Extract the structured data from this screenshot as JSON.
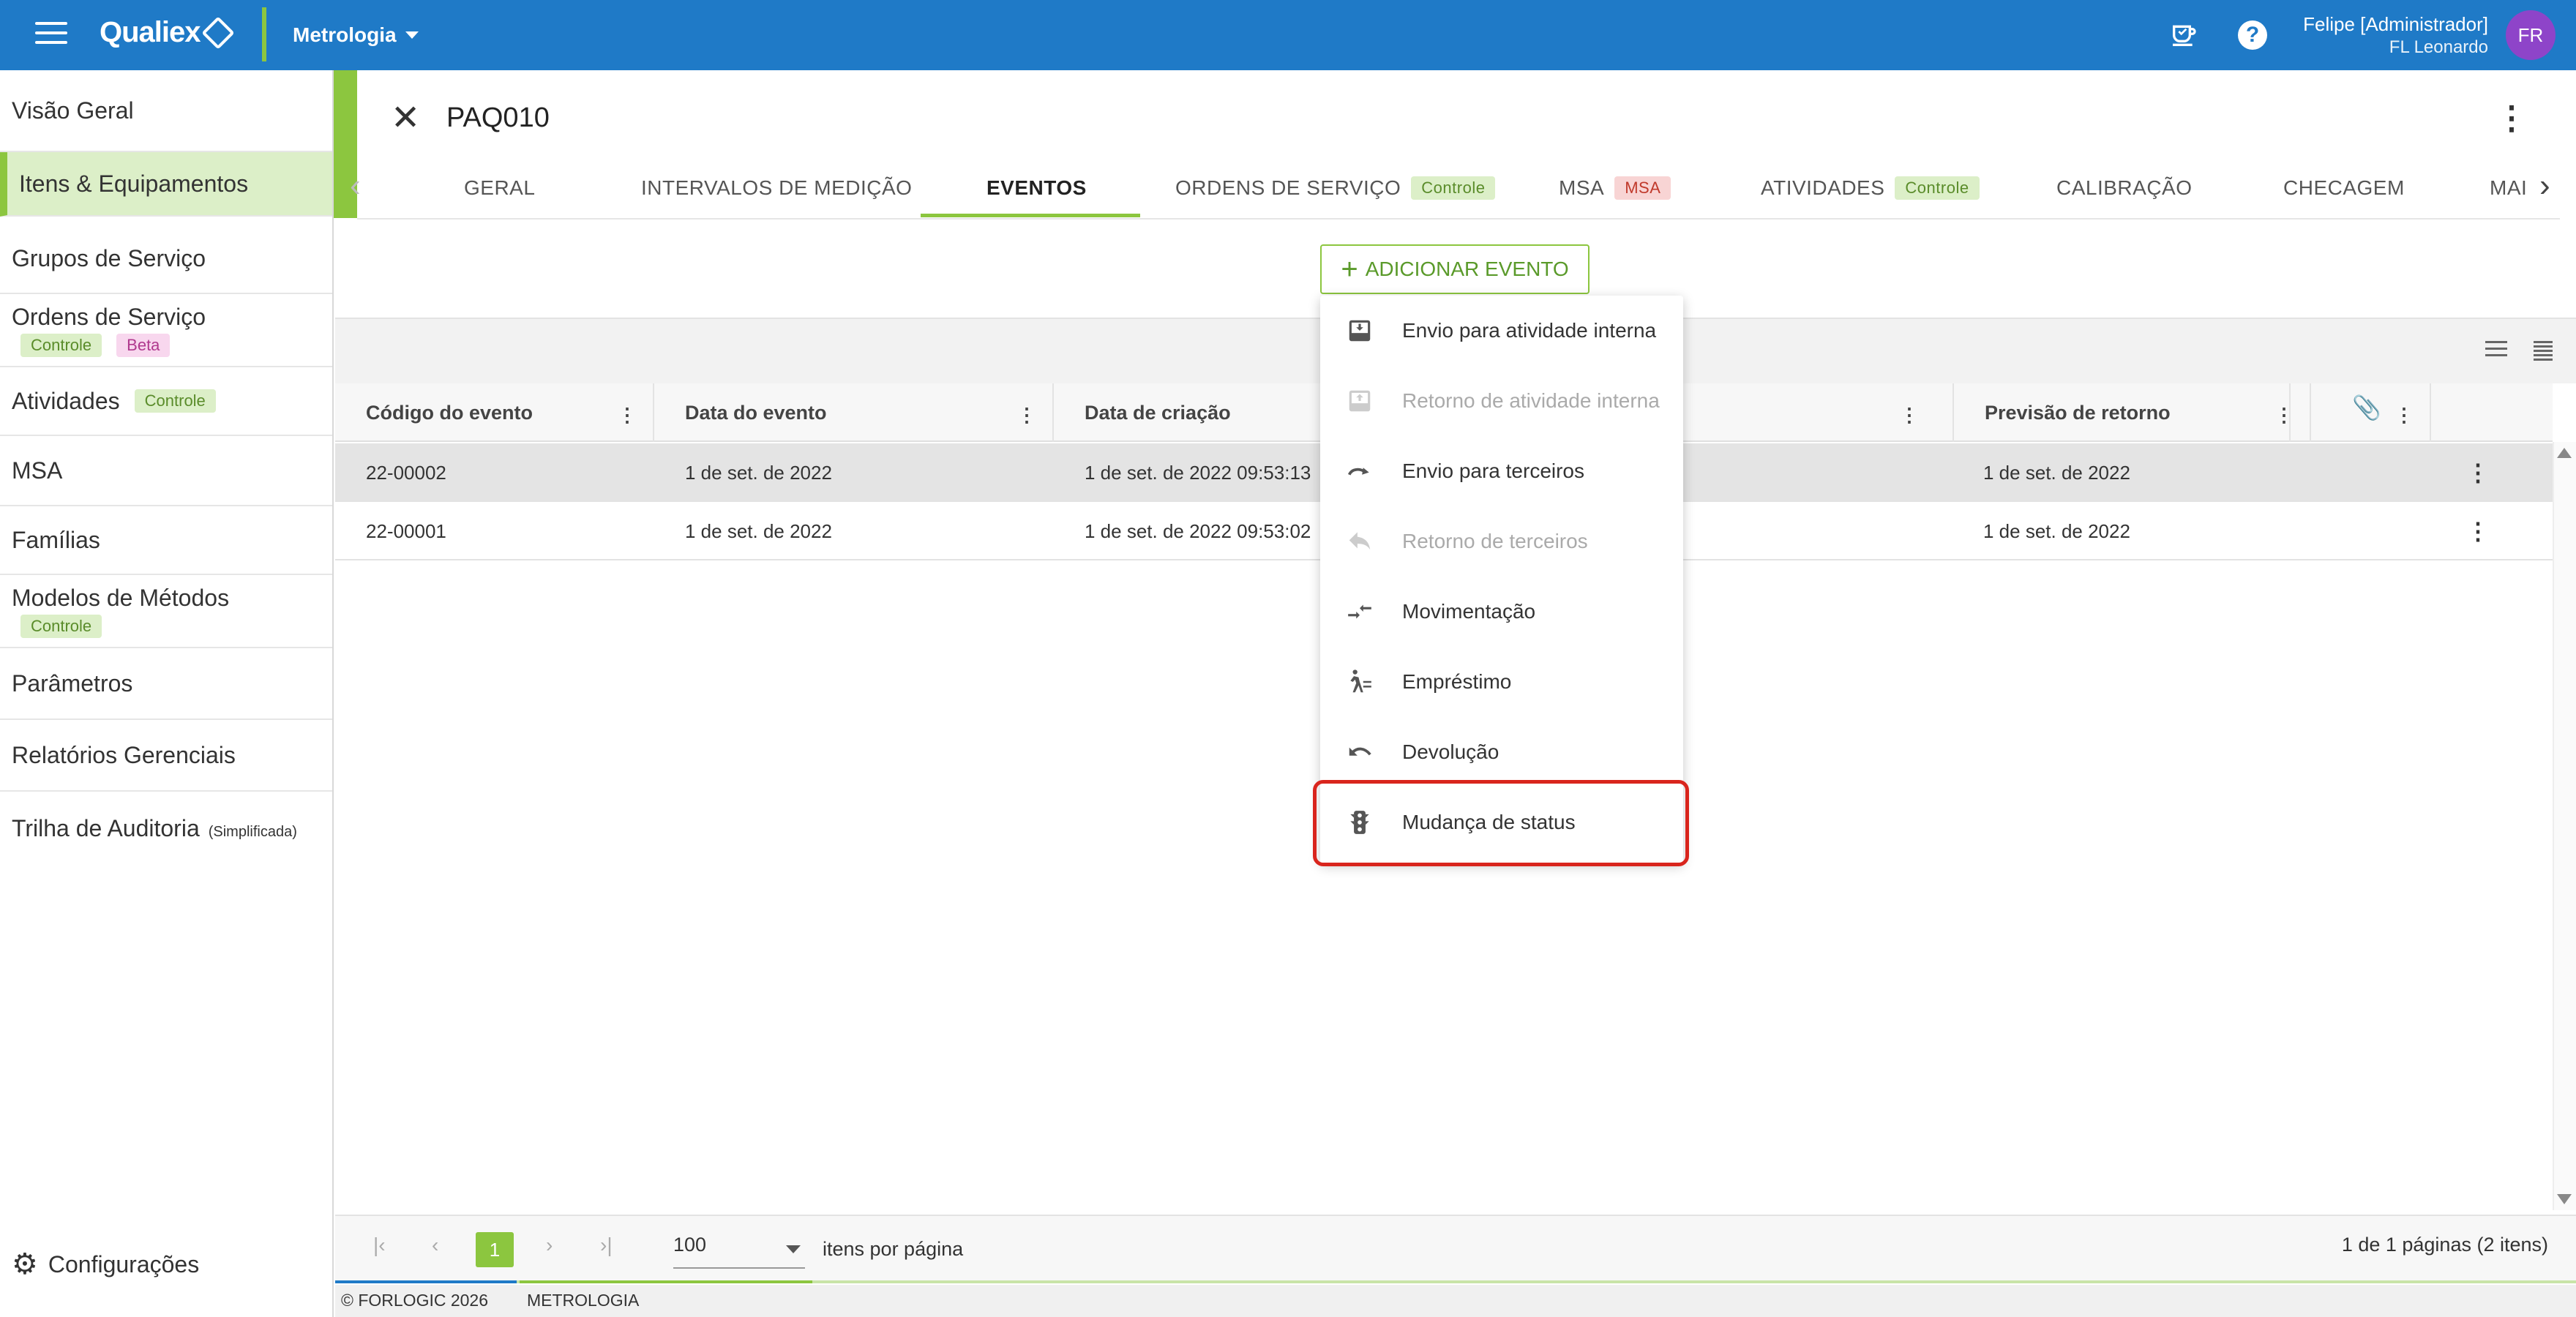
{
  "topbar": {
    "brand": "Qualiex",
    "module": "Metrologia",
    "user_name": "Felipe [Administrador]",
    "user_org": "FL Leonardo",
    "avatar_initials": "FR",
    "help_glyph": "?"
  },
  "sidebar": {
    "items": [
      {
        "label": "Visão Geral"
      },
      {
        "label": "Itens & Equipamentos"
      },
      {
        "label": "Grupos de Serviço"
      },
      {
        "label": "Ordens de Serviço",
        "badge1": "Controle",
        "badge2": "Beta"
      },
      {
        "label": "Atividades",
        "badge1": "Controle"
      },
      {
        "label": "MSA"
      },
      {
        "label": "Famílias"
      },
      {
        "label": "Modelos de Métodos",
        "badge1": "Controle"
      },
      {
        "label": "Parâmetros"
      },
      {
        "label": "Relatórios Gerenciais"
      },
      {
        "label": "Trilha de Auditoria",
        "small": "(Simplificada)"
      }
    ],
    "settings_label": "Configurações"
  },
  "record": {
    "title": "PAQ010"
  },
  "tabs": [
    {
      "label": "GERAL"
    },
    {
      "label": "INTERVALOS DE MEDIÇÃO"
    },
    {
      "label": "EVENTOS"
    },
    {
      "label": "ORDENS DE SERVIÇO",
      "badge": "Controle"
    },
    {
      "label": "MSA",
      "badge": "MSA"
    },
    {
      "label": "ATIVIDADES",
      "badge": "Controle"
    },
    {
      "label": "CALIBRAÇÃO"
    },
    {
      "label": "CHECAGEM"
    },
    {
      "label": "MAI"
    }
  ],
  "add_event_label": "ADICIONAR EVENTO",
  "menu": {
    "items": [
      {
        "label": "Envio para atividade interna",
        "icon": "inbox-upload-icon",
        "enabled": true
      },
      {
        "label": "Retorno de atividade interna",
        "icon": "inbox-download-icon",
        "enabled": false
      },
      {
        "label": "Envio para terceiros",
        "icon": "redo-arrow-icon",
        "enabled": true
      },
      {
        "label": "Retorno de terceiros",
        "icon": "reply-arrow-icon",
        "enabled": false
      },
      {
        "label": "Movimentação",
        "icon": "swap-arrows-icon",
        "enabled": true
      },
      {
        "label": "Empréstimo",
        "icon": "person-walking-icon",
        "enabled": true
      },
      {
        "label": "Devolução",
        "icon": "undo-arrow-icon",
        "enabled": true
      },
      {
        "label": "Mudança de status",
        "icon": "traffic-light-icon",
        "enabled": true
      }
    ]
  },
  "table": {
    "columns": [
      "Código do evento",
      "Data do evento",
      "Data de criação",
      "Previsão de retorno"
    ],
    "rows": [
      {
        "code": "22-00002",
        "event_date": "1 de set. de 2022",
        "created": "1 de set. de 2022 09:53:13",
        "return": "1 de set. de 2022"
      },
      {
        "code": "22-00001",
        "event_date": "1 de set. de 2022",
        "created": "1 de set. de 2022 09:53:02",
        "return": "1 de set. de 2022"
      }
    ]
  },
  "pager": {
    "current_page": "1",
    "page_size": "100",
    "page_size_label": "itens por página",
    "summary": "1 de 1 páginas (2 itens)"
  },
  "footer": {
    "copyright": "© FORLOGIC 2026",
    "module": "METROLOGIA"
  },
  "colors": {
    "topbar": "#1f7ac7",
    "accent_green": "#8cc63f",
    "highlight_red": "#d9251d",
    "avatar": "#8e44c9"
  }
}
